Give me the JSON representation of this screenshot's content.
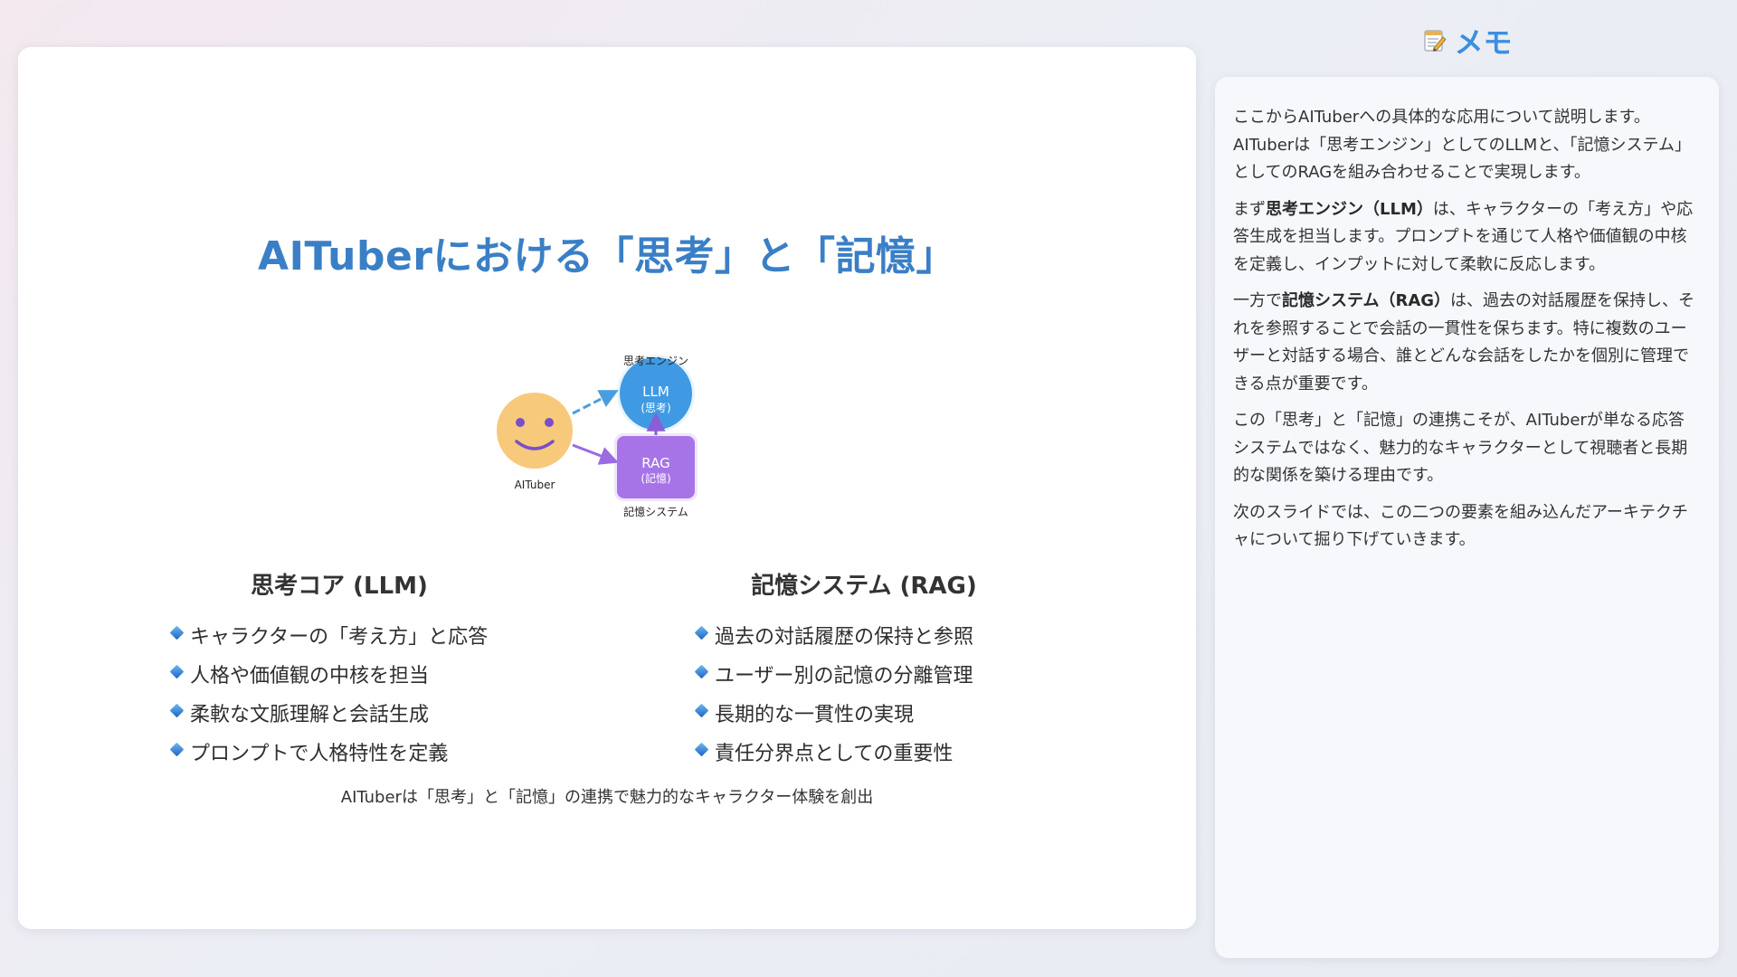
{
  "slide": {
    "title": "AITuberにおける「思考」と「記憶」",
    "diagram": {
      "engine_label": "思考エンジン",
      "llm_line1": "LLM",
      "llm_line2": "(思考)",
      "rag_line1": "RAG",
      "rag_line2": "(記憶)",
      "aituber_label": "AITuber",
      "memory_label": "記憶システム",
      "colors": {
        "face": "#f7c97a",
        "llm": "#3f9ae3",
        "rag": "#a774e8",
        "arrow_blue": "#4a9ee0",
        "arrow_purple": "#9b6be0"
      }
    },
    "left_column": {
      "heading": "思考コア (LLM)",
      "items": [
        "キャラクターの「考え方」と応答",
        "人格や価値観の中核を担当",
        "柔軟な文脈理解と会話生成",
        "プロンプトで人格特性を定義"
      ]
    },
    "right_column": {
      "heading": "記憶システム (RAG)",
      "items": [
        "過去の対話履歴の保持と参照",
        "ユーザー別の記憶の分離管理",
        "長期的な一貫性の実現",
        "責任分界点としての重要性"
      ]
    },
    "caption": "AITuberは「思考」と「記憶」の連携で魅力的なキャラクター体験を創出"
  },
  "memo": {
    "icon": "memo-icon",
    "title": "メモ",
    "paragraphs": [
      {
        "before": "ここからAITuberへの具体的な応用について説明します。AITuberは「思考エンジン」としてのLLMと、「記憶システム」としてのRAGを組み合わせることで実現します。",
        "bold": "",
        "after": ""
      },
      {
        "before": "まず",
        "bold": "思考エンジン（LLM）",
        "after": "は、キャラクターの「考え方」や応答生成を担当します。プロンプトを通じて人格や価値観の中核を定義し、インプットに対して柔軟に反応します。"
      },
      {
        "before": "一方で",
        "bold": "記憶システム（RAG）",
        "after": "は、過去の対話履歴を保持し、それを参照することで会話の一貫性を保ちます。特に複数のユーザーと対話する場合、誰とどんな会話をしたかを個別に管理できる点が重要です。"
      },
      {
        "before": "この「思考」と「記憶」の連携こそが、AITuberが単なる応答システムではなく、魅力的なキャラクターとして視聴者と長期的な関係を築ける理由です。",
        "bold": "",
        "after": ""
      },
      {
        "before": "次のスライドでは、この二つの要素を組み込んだアーキテクチャについて掘り下げていきます。",
        "bold": "",
        "after": ""
      }
    ]
  }
}
